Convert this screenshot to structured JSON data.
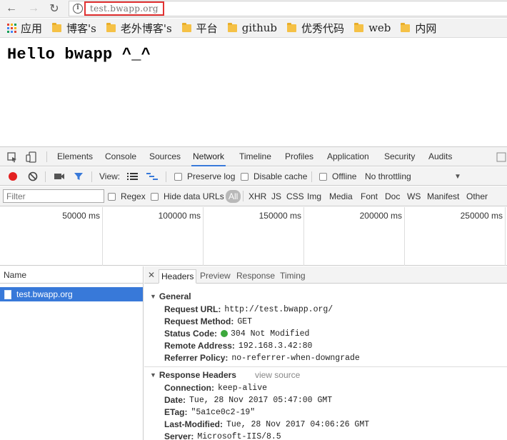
{
  "browser": {
    "url": "test.bwapp.org",
    "nav": {
      "back": "←",
      "forward": "→",
      "reload": "↻",
      "info": "i"
    },
    "bookmarks": [
      {
        "label": "应用",
        "icon": "apps-grid-icon"
      },
      {
        "label": "博客's",
        "icon": "folder-icon"
      },
      {
        "label": "老外博客's",
        "icon": "folder-icon"
      },
      {
        "label": "平台",
        "icon": "folder-icon"
      },
      {
        "label": "github",
        "icon": "folder-icon"
      },
      {
        "label": "优秀代码",
        "icon": "folder-icon"
      },
      {
        "label": "web",
        "icon": "folder-icon"
      },
      {
        "label": "内网",
        "icon": "folder-icon"
      }
    ],
    "apps_colors": [
      "#e44134",
      "#f4b400",
      "#0f9d58",
      "#4285f4",
      "#e44134",
      "#f4b400",
      "#0f9d58",
      "#4285f4",
      "#db4437"
    ],
    "folder_color": "#f5c146"
  },
  "page": {
    "heading": "Hello bwapp ^_^"
  },
  "devtools": {
    "tabs": [
      "Elements",
      "Console",
      "Sources",
      "Network",
      "Timeline",
      "Profiles",
      "Application",
      "Security",
      "Audits"
    ],
    "active_tab": "Network",
    "accent": "#3879d9",
    "toolbar": {
      "view_label": "View:",
      "preserve_log": "Preserve log",
      "disable_cache": "Disable cache",
      "offline": "Offline",
      "throttling": "No throttling",
      "dropdown_arrow": "▼"
    },
    "filter": {
      "placeholder": "Filter",
      "regex": "Regex",
      "hide_data_urls": "Hide data URLs",
      "types": [
        "All",
        "XHR",
        "JS",
        "CSS",
        "Img",
        "Media",
        "Font",
        "Doc",
        "WS",
        "Manifest",
        "Other"
      ]
    },
    "overview_ticks": [
      "50000 ms",
      "100000 ms",
      "150000 ms",
      "200000 ms",
      "250000 ms"
    ],
    "requests": {
      "header": "Name",
      "items": [
        "test.bwapp.org"
      ]
    },
    "details": {
      "close": "✕",
      "tabs": [
        "Headers",
        "Preview",
        "Response",
        "Timing"
      ],
      "active_tab": "Headers",
      "general": {
        "title": "General",
        "rows": [
          {
            "key": "Request URL:",
            "value": "http://test.bwapp.org/"
          },
          {
            "key": "Request Method:",
            "value": "GET"
          },
          {
            "key": "Status Code:",
            "value": "304 Not Modified"
          },
          {
            "key": "Remote Address:",
            "value": "192.168.3.42:80"
          },
          {
            "key": "Referrer Policy:",
            "value": "no-referrer-when-downgrade"
          }
        ],
        "status_color": "#3ca83c"
      },
      "response_headers": {
        "title": "Response Headers",
        "view_source": "view source",
        "rows": [
          {
            "key": "Connection:",
            "value": "keep-alive"
          },
          {
            "key": "Date:",
            "value": "Tue, 28 Nov 2017 05:47:00 GMT"
          },
          {
            "key": "ETag:",
            "value": "\"5a1ce0c2-19\""
          },
          {
            "key": "Last-Modified:",
            "value": "Tue, 28 Nov 2017 04:06:26 GMT"
          },
          {
            "key": "Server:",
            "value": "Microsoft-IIS/8.5"
          }
        ]
      }
    }
  }
}
